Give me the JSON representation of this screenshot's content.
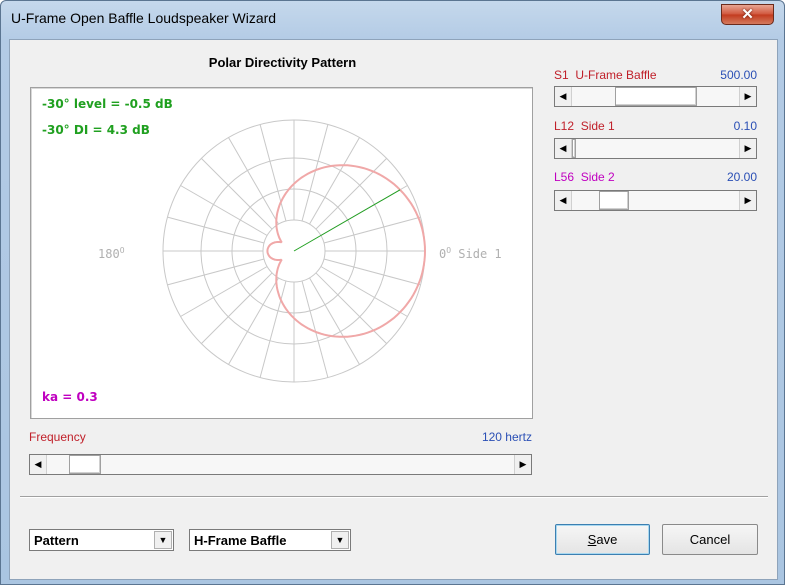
{
  "window": {
    "title": "U-Frame Open Baffle Loudspeaker Wizard",
    "close_glyph": "✕"
  },
  "plot": {
    "title": "Polar Directivity Pattern",
    "level_text": "-30° level = -0.5 dB",
    "di_text": "-30° DI = 4.3 dB",
    "ka_text": "ka = 0.3",
    "label_left": "180",
    "label_right_num": "0",
    "label_right_text": "Side 1",
    "degree_mark": "O",
    "colors": {
      "pattern": "#f0a8a8",
      "indicator": "#20a020",
      "grid": "#c8c8c8"
    },
    "chart_data": {
      "type": "polar",
      "indicator_angle_deg": 30,
      "level_at_minus30_db": -0.5,
      "di_at_minus30_db": 4.3,
      "ka": 0.3
    }
  },
  "params": [
    {
      "code": "S1",
      "name": "U-Frame Baffle",
      "value": "500.00",
      "color": "#c0202a",
      "position": 0.5
    },
    {
      "code": "L12",
      "name": "Side 1",
      "value": "0.10",
      "color": "#c0202a",
      "position": 0.0
    },
    {
      "code": "L56",
      "name": "Side 2",
      "value": "20.00",
      "color": "#c000c0",
      "position": 0.2
    }
  ],
  "frequency": {
    "label": "Frequency",
    "value": "120 hertz",
    "position": 0.05
  },
  "controls": {
    "view_combo": "Pattern",
    "type_combo": "H-Frame Baffle",
    "combo_arrow": "▼",
    "save_label": "Save",
    "cancel_label": "Cancel"
  },
  "arrows": {
    "left": "◀",
    "right": "▶"
  }
}
